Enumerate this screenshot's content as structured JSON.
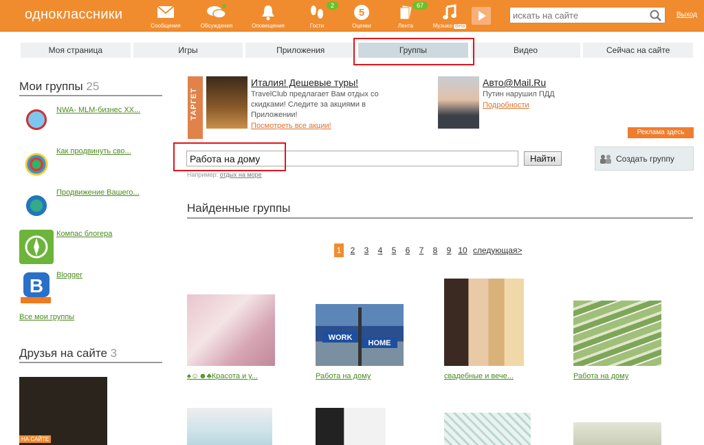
{
  "header": {
    "logo": "одноклассники",
    "tools": [
      {
        "label": "Сообщения",
        "icon": "envelope-icon"
      },
      {
        "label": "Обсуждения",
        "icon": "speech-bubbles-icon"
      },
      {
        "label": "Оповещения",
        "icon": "bell-icon"
      },
      {
        "label": "Гости",
        "icon": "footprints-icon",
        "badge": "2"
      },
      {
        "label": "Оценки",
        "icon": "rating-five-icon",
        "badge_value": "5"
      },
      {
        "label": "Лента",
        "icon": "feed-icon",
        "badge": "67"
      },
      {
        "label": "Музыка",
        "icon": "music-note-icon",
        "beta": "Beta"
      }
    ],
    "search_placeholder": "искать на сайте",
    "exit_label": "Выход"
  },
  "nav": [
    "Моя страница",
    "Игры",
    "Приложения",
    "Группы",
    "Видео",
    "Сейчас на сайте"
  ],
  "nav_active": "Группы",
  "sidebar": {
    "my_groups_title": "Мои группы",
    "my_groups_count": "25",
    "groups": [
      {
        "name": "NWA- MLM-бизнес XX..."
      },
      {
        "name": "Как продвинуть сво..."
      },
      {
        "name": "Продвижение Вашего..."
      },
      {
        "name": "Компас блогера"
      },
      {
        "name": "Blogger"
      }
    ],
    "all_groups_label": "Все мои группы",
    "friends_title": "Друзья на сайте",
    "friends_count": "3",
    "friend_tag": "НА САЙТЕ"
  },
  "ads": {
    "target_label": "ТАРГЕТ",
    "ad1": {
      "title": "Италия! Дешевые туры!",
      "text_lines": [
        "TravelClub предлагает Вам отдых со",
        "скидками! Следите за акциями в",
        "Приложении!"
      ],
      "link": "Посмотреть все акции!"
    },
    "ad2": {
      "title": "Авто@Mail.Ru",
      "text": "Путин нарушил ПДД",
      "link": "Подробности"
    },
    "ad_here": "Реклама здесь"
  },
  "group_search": {
    "value": "Работа на дому",
    "button": "Найти",
    "example_prefix": "Например:",
    "example_link": "отдых на море"
  },
  "create_group_label": "Создать группу",
  "results_title": "Найденные группы",
  "pager": {
    "pages": [
      "1",
      "2",
      "3",
      "4",
      "5",
      "6",
      "7",
      "8",
      "9",
      "10"
    ],
    "current": "1",
    "next": "следующая>"
  },
  "results": [
    {
      "caption": "♠☺☻♣Красота и у..."
    },
    {
      "caption": "Работа на дому"
    },
    {
      "caption": "свадебные и вече..."
    },
    {
      "caption": "Работа на дому"
    }
  ],
  "colors": {
    "brand_orange": "#f08c2e",
    "link_green": "#4a8a1e",
    "highlight_red": "#e3131b"
  }
}
